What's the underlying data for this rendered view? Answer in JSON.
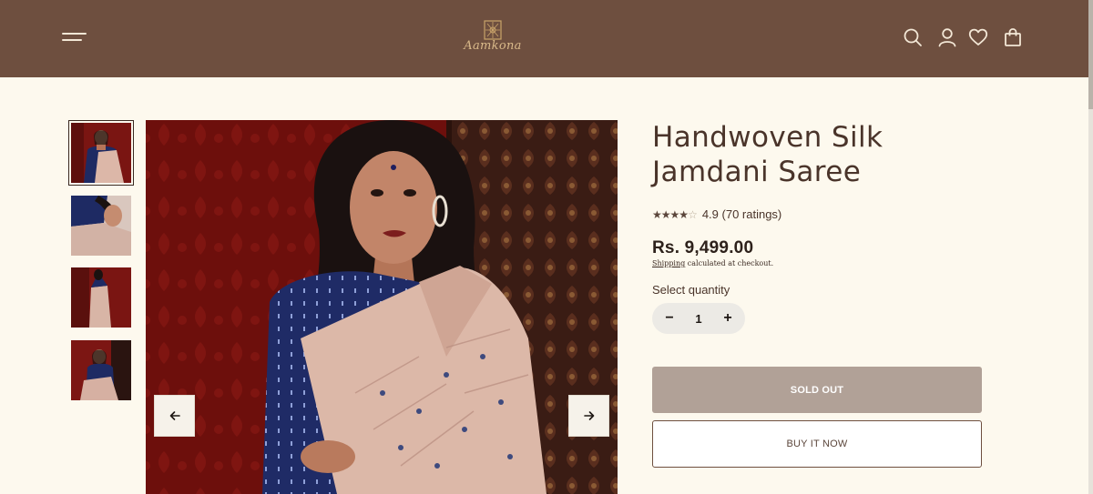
{
  "header": {
    "brand": "Aamkona",
    "menu_icon": "menu-icon",
    "icons": [
      "search-icon",
      "account-icon",
      "wishlist-icon",
      "cart-icon"
    ],
    "background": "#6e4f3f"
  },
  "gallery": {
    "thumbnails": [
      {
        "name": "thumbnail-1",
        "active": true
      },
      {
        "name": "thumbnail-2",
        "active": false
      },
      {
        "name": "thumbnail-3",
        "active": false
      },
      {
        "name": "thumbnail-4",
        "active": false
      }
    ],
    "prev_icon": "arrow-left-icon",
    "next_icon": "arrow-right-icon"
  },
  "product": {
    "title_line1": "Handwoven Silk",
    "title_line2": "Jamdani Saree",
    "rating_value": 4.5,
    "rating_text": "4.9 (70 ratings)",
    "price": "Rs. 9,499.00",
    "shipping_link": "Shipping",
    "shipping_text": " calculated at checkout.",
    "quantity_label": "Select quantity",
    "quantity": "1",
    "decrement": "−",
    "increment": "+",
    "sold_out_label": "SOLD OUT",
    "buy_now_label": "BUY IT NOW"
  },
  "colors": {
    "accent": "#6e4f3f",
    "sold_out_bg": "#b1a197",
    "page_bg": "#fdf9ee"
  }
}
